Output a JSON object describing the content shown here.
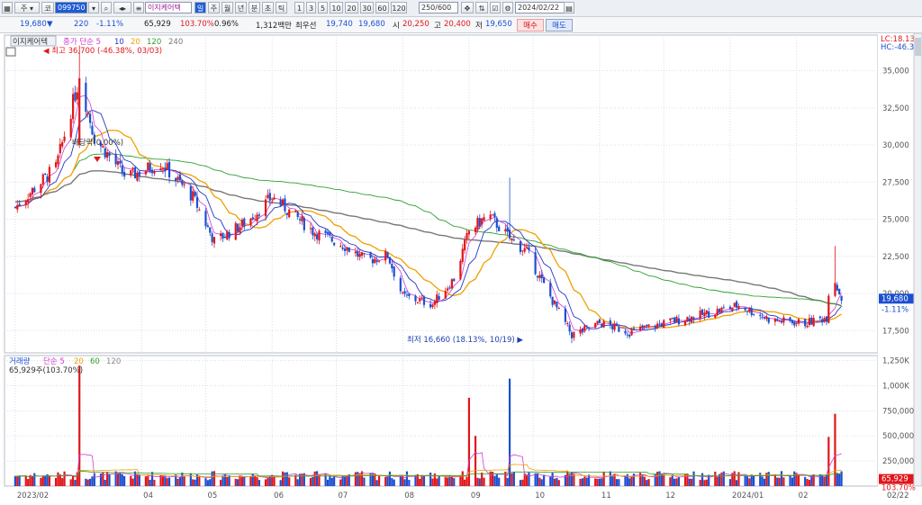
{
  "toolbar": {
    "market_label": "주",
    "code_label": "코",
    "code_value": "099750",
    "stock_name": "이지케어텍",
    "periods": [
      "일",
      "주",
      "월",
      "년",
      "분",
      "초",
      "틱"
    ],
    "minutes": [
      "1",
      "3",
      "5",
      "10",
      "20",
      "30",
      "60",
      "120"
    ],
    "count": "250/600",
    "date": "2024/02/22"
  },
  "quote": {
    "price": "19,680",
    "change": "220",
    "change_pct": "-1.11%",
    "volume": "65,929",
    "vol_ratio": "103.70%",
    "turnover": "0.96%",
    "amount": "1,312백만",
    "best_ask_label": "최우선",
    "best_ask": "19,740",
    "best_bid": "19,680",
    "open_label": "시",
    "open": "20,250",
    "high_label": "고",
    "high": "20,400",
    "low_label": "저",
    "low": "19,650",
    "buy_label": "매수",
    "sell_label": "매도"
  },
  "price_panel": {
    "legend_name": "이지케어텍",
    "legend_close": "종가 단순 5",
    "legend_ma": [
      "10",
      "20",
      "120",
      "240"
    ],
    "lc": "LC:18.13",
    "hc": "HC:-46.38",
    "high_note": "최고 36,700 (-46.38%, 03/03)",
    "low_note": "최저 16,660 (18.13%, 10/19)",
    "dividend_note": "배당락(0.00%)",
    "last_price": "19,680",
    "last_change": "-1.11%"
  },
  "volume_panel": {
    "legend_vol": "거래량",
    "legend_simple": "단순 5",
    "legend_ma": [
      "20",
      "60",
      "120"
    ],
    "current": "65,929주(103.70%)",
    "last_value": "65,929",
    "last_pct": "103.70%"
  },
  "colors": {
    "up": "#e0161b",
    "down": "#1c4fd0",
    "ma5": "#d13bd3",
    "ma10": "#2637c7",
    "ma20": "#f0a000",
    "ma120": "#2ca02c",
    "ma240": "#777777"
  },
  "chart_data": {
    "type": "candlestick",
    "y_ticks": [
      "35,000",
      "32,500",
      "30,000",
      "27,500",
      "25,000",
      "22,500",
      "20,000",
      "17,500"
    ],
    "ylim": [
      16000,
      37400
    ],
    "vol_ticks": [
      "1,250K",
      "1,000K",
      "750,000",
      "500,000",
      "250,000"
    ],
    "vol_ylim": [
      0,
      1300000
    ],
    "x_ticks": [
      "2023/02",
      "04",
      "05",
      "06",
      "07",
      "08",
      "09",
      "10",
      "11",
      "12",
      "2024/01",
      "02",
      "02/22"
    ],
    "x_tick_dates": [
      "2023-02-01",
      "2023-04-01",
      "2023-05-01",
      "2023-06-01",
      "2023-07-01",
      "2023-08-01",
      "2023-09-01",
      "2023-10-01",
      "2023-11-01",
      "2023-12-01",
      "2024-01-01",
      "2024-02-01",
      "2024-02-22"
    ],
    "price_keypoints": [
      [
        "2023-02-01",
        25800
      ],
      [
        "2023-02-20",
        28500
      ],
      [
        "2023-03-03",
        34500
      ],
      [
        "2023-03-10",
        30500
      ],
      [
        "2023-03-25",
        27800
      ],
      [
        "2023-04-10",
        28800
      ],
      [
        "2023-04-25",
        26500
      ],
      [
        "2023-05-05",
        23500
      ],
      [
        "2023-05-20",
        24800
      ],
      [
        "2023-06-01",
        26500
      ],
      [
        "2023-06-20",
        24200
      ],
      [
        "2023-07-05",
        23200
      ],
      [
        "2023-07-15",
        22200
      ],
      [
        "2023-07-25",
        22600
      ],
      [
        "2023-08-01",
        19800
      ],
      [
        "2023-08-15",
        19300
      ],
      [
        "2023-08-25",
        21000
      ],
      [
        "2023-09-01",
        24200
      ],
      [
        "2023-09-10",
        25300
      ],
      [
        "2023-09-20",
        23700
      ],
      [
        "2023-09-28",
        22800
      ],
      [
        "2023-10-05",
        20800
      ],
      [
        "2023-10-19",
        17200
      ],
      [
        "2023-11-01",
        18000
      ],
      [
        "2023-11-15",
        17400
      ],
      [
        "2023-12-01",
        18000
      ],
      [
        "2023-12-20",
        18600
      ],
      [
        "2024-01-05",
        19200
      ],
      [
        "2024-01-20",
        18200
      ],
      [
        "2024-02-05",
        18000
      ],
      [
        "2024-02-15",
        18400
      ],
      [
        "2024-02-17",
        21800
      ],
      [
        "2024-02-20",
        20400
      ],
      [
        "2024-02-22",
        19680
      ]
    ],
    "volume_spikes": [
      [
        "2023-03-03",
        1200000
      ],
      [
        "2023-09-01",
        880000
      ],
      [
        "2023-09-04",
        500000
      ],
      [
        "2023-09-20",
        1070000
      ],
      [
        "2024-02-17",
        490000
      ],
      [
        "2024-02-19",
        720000
      ]
    ]
  }
}
